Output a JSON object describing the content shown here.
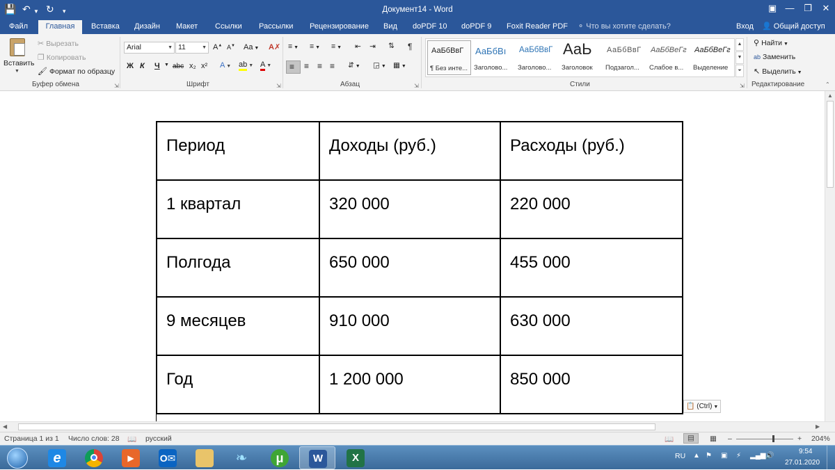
{
  "window": {
    "title": "Документ14 - Word"
  },
  "tabs": [
    "Файл",
    "Главная",
    "Вставка",
    "Дизайн",
    "Макет",
    "Ссылки",
    "Рассылки",
    "Рецензирование",
    "Вид",
    "doPDF 10",
    "doPDF 9",
    "Foxit Reader PDF"
  ],
  "tell_me": "Что вы хотите сделать?",
  "signin": "Вход",
  "share": "Общий доступ",
  "clipboard": {
    "paste": "Вставить",
    "cut": "Вырезать",
    "copy": "Копировать",
    "format_painter": "Формат по образцу",
    "label": "Буфер обмена"
  },
  "font": {
    "name": "Arial",
    "size": "11",
    "label": "Шрифт",
    "bold": "Ж",
    "italic": "К",
    "underline": "Ч",
    "strike": "abc",
    "sub": "x₂",
    "sup": "x²",
    "grow": "A",
    "shrink": "A",
    "case": "Aa"
  },
  "paragraph": {
    "label": "Абзац"
  },
  "styles": {
    "label": "Стили",
    "items": [
      {
        "preview": "АаБбВвГ",
        "name": "¶ Без инте..."
      },
      {
        "preview": "АаБбВı",
        "name": "Заголово..."
      },
      {
        "preview": "АаБбВвГ",
        "name": "Заголово..."
      },
      {
        "preview": "АаЬ",
        "name": "Заголовок"
      },
      {
        "preview": "АаБбВвГ",
        "name": "Подзагол..."
      },
      {
        "preview": "АаБбВеГг",
        "name": "Слабое в..."
      },
      {
        "preview": "АаБбВеГг",
        "name": "Выделение"
      }
    ]
  },
  "editing": {
    "find": "Найти",
    "replace": "Заменить",
    "select": "Выделить",
    "label": "Редактирование"
  },
  "table": {
    "rows": [
      [
        "Период",
        "Доходы (руб.)",
        "Расходы (руб.)"
      ],
      [
        "1 квартал",
        "320 000",
        "220 000"
      ],
      [
        "Полгода",
        "650 000",
        "455 000"
      ],
      [
        "9 месяцев",
        "910 000",
        "630 000"
      ],
      [
        "Год",
        "1 200 000",
        "850 000"
      ]
    ]
  },
  "paste_options": "(Ctrl)",
  "status": {
    "page": "Страница 1 из 1",
    "words": "Число слов: 28",
    "language": "русский",
    "zoom": "204%"
  },
  "taskbar": {
    "lang": "RU",
    "time": "9:54",
    "date": "27.01.2020"
  },
  "colors": {
    "accent": "#2b579a"
  }
}
